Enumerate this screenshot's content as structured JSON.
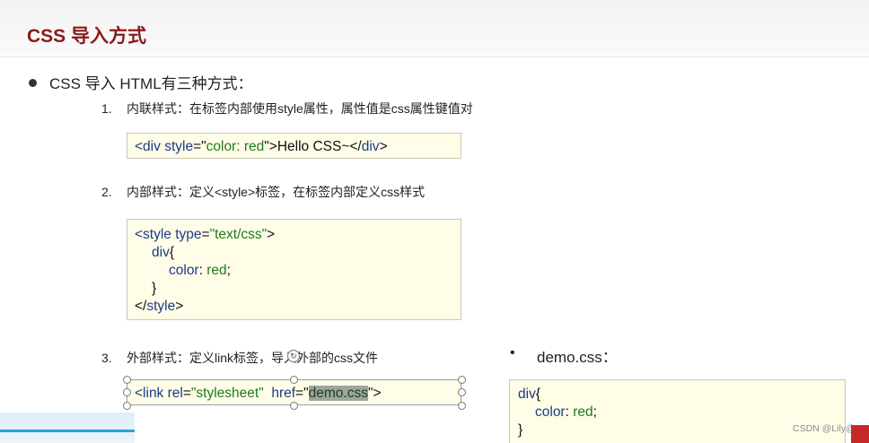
{
  "slide": {
    "title": "CSS 导入方式",
    "bullet": "CSS 导入 HTML有三种方式：",
    "items": [
      {
        "num": "1.",
        "text": "内联样式：在标签内部使用style属性，属性值是css属性键值对"
      },
      {
        "num": "2.",
        "text": "内部样式：定义<style>标签，在标签内部定义css样式"
      },
      {
        "num": "3.",
        "text": "外部样式：定义link标签，导入外部的css文件"
      }
    ],
    "code_inline": {
      "open_tag": "<div",
      "attr_name": "style",
      "eq_quote_open": "=\"",
      "attr_value": "color: red",
      "quote_close": "\"",
      "text": ">Hello CSS~</",
      "close_name": "div",
      "end": ">"
    },
    "code_internal": {
      "l1_tag": "<style",
      "l1_attr": " type",
      "l1_eq": "=",
      "l1_val": "\"text/css\"",
      "l1_end": ">",
      "l2_sel": "div",
      "l2_brace": "{",
      "l3_prop": "color",
      "l3_colon": ": ",
      "l3_val": "red",
      "l3_semi": ";",
      "l4": "}",
      "l5_open": "</",
      "l5_name": "style",
      "l5_end": ">"
    },
    "code_link": {
      "open": "<link",
      "rel_name": " rel",
      "rel_eq": "=",
      "rel_val": "\"stylesheet\"",
      "href_name": "  href",
      "href_eq": "=",
      "href_q1": "\"",
      "href_val": "demo.css",
      "href_q2": "\"",
      "end": ">"
    },
    "demo": {
      "label": "demo.css：",
      "l1_sel": "div",
      "l1_brace": "{",
      "l2_prop": "color",
      "l2_colon": ": ",
      "l2_val": "red",
      "l2_semi": ";",
      "l3": "}"
    }
  },
  "watermark": "CSDN @Lily@"
}
